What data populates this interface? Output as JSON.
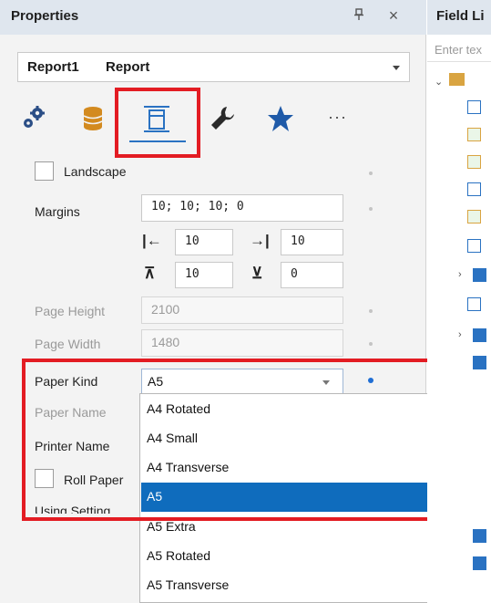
{
  "properties_panel": {
    "title": "Properties",
    "pin_icon": "pin-icon",
    "close_icon": "close-icon",
    "selector": {
      "name": "Report1",
      "type": "Report"
    },
    "tabs": [
      {
        "id": "behavior",
        "icon": "gears-icon"
      },
      {
        "id": "data",
        "icon": "database-icon"
      },
      {
        "id": "page-settings",
        "icon": "page-layout-icon",
        "active": true
      },
      {
        "id": "tools",
        "icon": "wrench-icon"
      },
      {
        "id": "favorites",
        "icon": "star-icon"
      },
      {
        "id": "more",
        "icon": "more-icon",
        "label": "···"
      }
    ],
    "landscape_label": "Landscape",
    "margins": {
      "label": "Margins",
      "value": "10; 10; 10; 0",
      "left": "10",
      "right": "10",
      "top": "10",
      "bottom": "0"
    },
    "page_height": {
      "label": "Page Height",
      "value": "2100"
    },
    "page_width": {
      "label": "Page Width",
      "value": "1480"
    },
    "paper_kind": {
      "label": "Paper Kind",
      "value": "A5"
    },
    "paper_name": {
      "label": "Paper Name"
    },
    "printer_name": {
      "label": "Printer Name"
    },
    "roll_paper": {
      "label": "Roll Paper"
    },
    "using_setting": {
      "label": "Using Setting"
    },
    "dropdown_options": [
      {
        "label": "A4 Rotated",
        "selected": false
      },
      {
        "label": "A4 Small",
        "selected": false
      },
      {
        "label": "A4 Transverse",
        "selected": false
      },
      {
        "label": "A5",
        "selected": true
      },
      {
        "label": "A5 Extra",
        "selected": false
      },
      {
        "label": "A5 Rotated",
        "selected": false
      },
      {
        "label": "A5 Transverse",
        "selected": false
      }
    ]
  },
  "field_list": {
    "title": "Field Li",
    "search_placeholder": "Enter tex"
  },
  "colors": {
    "highlight": "#e31c23",
    "selection": "#0f6cbd",
    "accent": "#2a72c2",
    "header": "#dfe6ee"
  }
}
